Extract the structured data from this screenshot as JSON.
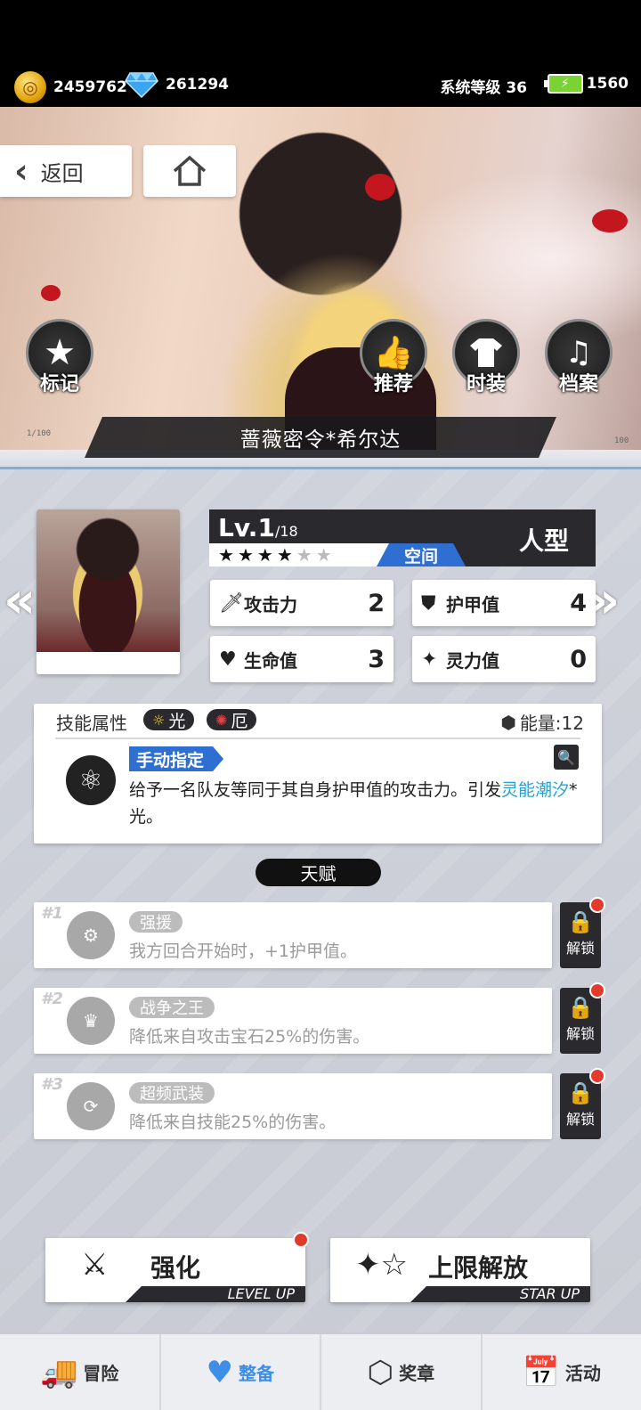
{
  "status": {
    "gold": "2459762",
    "diamonds": "261294",
    "system_level": "系统等级 36",
    "stamina": "1560"
  },
  "hero": {
    "back_label": "返回",
    "buttons": {
      "mark": "标记",
      "recommend": "推荐",
      "fashion": "时装",
      "archive": "档案"
    },
    "name": "蔷薇密令*希尔达",
    "deco_left": "1/100",
    "deco_right": "100"
  },
  "character": {
    "level": "Lv.1",
    "level_max": "/18",
    "type": "人型",
    "element": "空间",
    "stars_filled": 4,
    "stars_total": 6,
    "stats": {
      "attack_label": "攻击力",
      "attack_value": "2",
      "armor_label": "护甲值",
      "armor_value": "4",
      "hp_label": "生命值",
      "hp_value": "3",
      "spirit_label": "灵力值",
      "spirit_value": "0"
    }
  },
  "skill": {
    "header": "技能属性",
    "attr1": "光",
    "attr2": "厄",
    "energy": "能量:12",
    "tag": "手动指定",
    "desc_part1": "给予一名队友等同于其自身护甲值的攻击力。引发",
    "desc_highlight": "灵能潮汐",
    "desc_part2": "*光。"
  },
  "talent": {
    "title": "天赋",
    "unlock_label": "解锁",
    "items": [
      {
        "num": "#1",
        "name": "强援",
        "desc": "我方回合开始时，+1护甲值。"
      },
      {
        "num": "#2",
        "name": "战争之王",
        "desc": "降低来自攻击宝石25%的伤害。"
      },
      {
        "num": "#3",
        "name": "超频武装",
        "desc": "降低来自技能25%的伤害。"
      }
    ]
  },
  "actions": {
    "level_up": "强化",
    "level_up_sub": "LEVEL UP",
    "star_up": "上限解放",
    "star_up_sub": "STAR UP"
  },
  "nav": {
    "adventure": "冒险",
    "equip": "整备",
    "medal": "奖章",
    "event": "活动"
  },
  "colors": {
    "accent_blue": "#2f6fd1",
    "highlight": "#21a3d8",
    "badge_red": "#e23a2c",
    "nav_active": "#3d8ee6"
  }
}
